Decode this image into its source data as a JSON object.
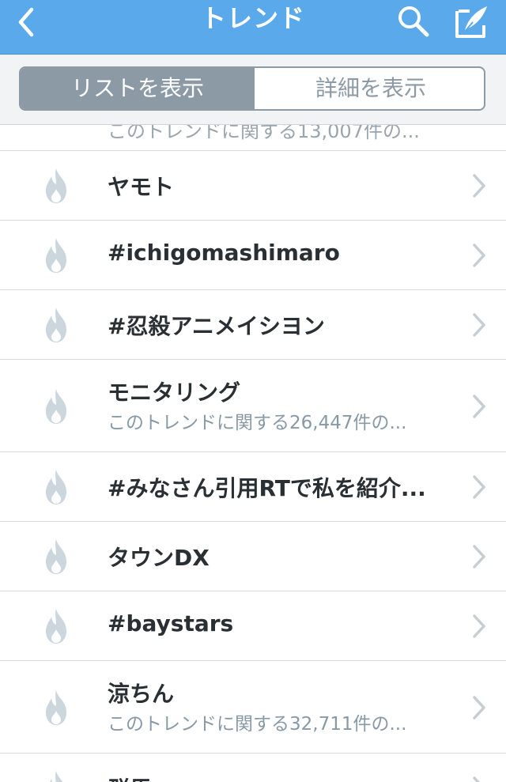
{
  "navbar": {
    "title": "トレンド",
    "back_icon": "chevron-left-icon",
    "search_icon": "search-icon",
    "compose_icon": "compose-tweet-icon",
    "color": "#5aa9ea"
  },
  "segmented": {
    "list_label": "リストを表示",
    "detail_label": "詳細を表示",
    "active": "list"
  },
  "partial_top_text": "このトレンドに関する13,007件の...",
  "trends": [
    {
      "title": "ヤモト",
      "subtitle": ""
    },
    {
      "title": "#ichigomashimaro",
      "subtitle": ""
    },
    {
      "title": "#忍殺アニメイシヨン",
      "subtitle": ""
    },
    {
      "title": "モニタリング",
      "subtitle": "このトレンドに関する26,447件の..."
    },
    {
      "title": "#みなさん引用RTで私を紹介...",
      "subtitle": ""
    },
    {
      "title": "タウンDX",
      "subtitle": ""
    },
    {
      "title": "#baystars",
      "subtitle": ""
    },
    {
      "title": "涼ちん",
      "subtitle": "このトレンドに関する32,711件の..."
    },
    {
      "title": "群馬",
      "subtitle": ""
    }
  ],
  "icons": {
    "trend": "flame-icon",
    "row_arrow": "chevron-right-icon"
  }
}
